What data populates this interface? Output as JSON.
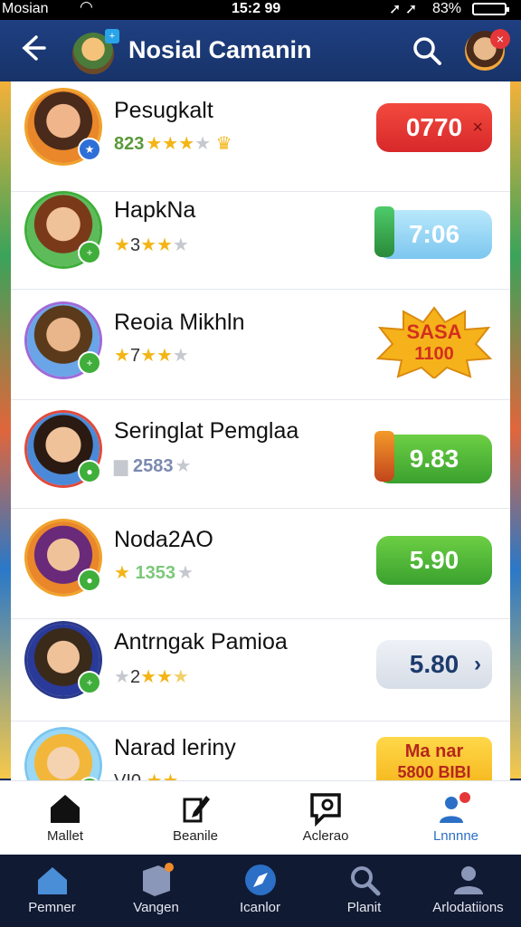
{
  "status_bar": {
    "carrier": "Mosian",
    "time": "15:2 99",
    "battery": "83%"
  },
  "header": {
    "title": "Nosial Camanin",
    "tag": "+",
    "notification_count": "×"
  },
  "rows": [
    {
      "name": "Pesugkalt",
      "rating": "823",
      "stars": 5,
      "filled": 3,
      "action": {
        "type": "pill-red",
        "value": "0770",
        "extra": "×"
      }
    },
    {
      "name": "HapkNa",
      "rating": "3",
      "stars": 4,
      "filled": 3,
      "action": {
        "type": "pill-blue",
        "value": "7:06"
      }
    },
    {
      "name": "Reoia Mikhln",
      "rating": "7",
      "stars": 4,
      "filled": 3,
      "action": {
        "type": "burst",
        "line1": "SASA",
        "line2": "1100"
      }
    },
    {
      "name": "Seringlat Pemglaa",
      "rating": "2583",
      "stars": 1,
      "filled": 0,
      "action": {
        "type": "pill-green",
        "value": "9.83"
      }
    },
    {
      "name": "Noda2AO",
      "rating": "1353",
      "stars": 2,
      "filled": 1,
      "action": {
        "type": "pill-green",
        "value": "5.90"
      }
    },
    {
      "name": "Antrngak Pamioa",
      "rating": "2",
      "stars": 4,
      "filled": 2,
      "action": {
        "type": "pill-light",
        "value": "5.80",
        "extra": "›"
      }
    },
    {
      "name": "Narad leriny",
      "rating": "VI0",
      "stars": 3,
      "filled": 2,
      "action": {
        "type": "banner",
        "line1": "Ma nar",
        "line2": "5800 BIBI"
      }
    }
  ],
  "tabs": [
    {
      "label": "Mallet",
      "icon": "home-icon"
    },
    {
      "label": "Beanile",
      "icon": "edit-icon"
    },
    {
      "label": "Aclerao",
      "icon": "chat-icon"
    },
    {
      "label": "Lnnnne",
      "icon": "users-icon"
    }
  ],
  "nav": [
    {
      "label": "Pemner",
      "icon": "house-icon"
    },
    {
      "label": "Vangen",
      "icon": "box-icon"
    },
    {
      "label": "Icanlor",
      "icon": "compass-icon"
    },
    {
      "label": "Planit",
      "icon": "search-icon"
    },
    {
      "label": "Arlodatiions",
      "icon": "person-icon"
    }
  ],
  "colors": {
    "header": "#1f3f82",
    "accent_red": "#e5363a",
    "accent_green": "#3aa12e",
    "nav_bg": "#111a33"
  }
}
